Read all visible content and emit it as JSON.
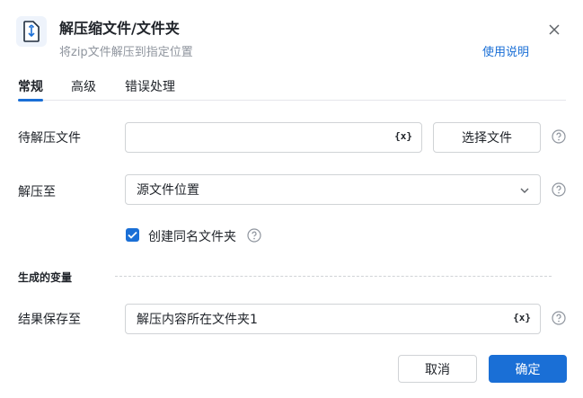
{
  "header": {
    "title": "解压缩文件/文件夹",
    "subtitle": "将zip文件解压到指定位置",
    "help_link": "使用说明",
    "icon": "zip-file-icon",
    "close_icon": "close-icon"
  },
  "tabs": [
    {
      "label": "常规",
      "active": true
    },
    {
      "label": "高级",
      "active": false
    },
    {
      "label": "错误处理",
      "active": false
    }
  ],
  "form": {
    "file_to_extract": {
      "label": "待解压文件",
      "value": "",
      "var_icon": "{x}",
      "button_label": "选择文件"
    },
    "extract_to": {
      "label": "解压至",
      "value": "源文件位置"
    },
    "create_same_name_folder": {
      "label": "创建同名文件夹",
      "checked": true
    }
  },
  "output": {
    "section_title": "生成的变量",
    "result_save_to": {
      "label": "结果保存至",
      "value": "解压内容所在文件夹1",
      "var_icon": "{x}"
    }
  },
  "footer": {
    "cancel_label": "取消",
    "ok_label": "确定"
  },
  "colors": {
    "accent": "#1a6fd6",
    "border": "#d0d3d6",
    "muted_text": "#8f959e"
  }
}
